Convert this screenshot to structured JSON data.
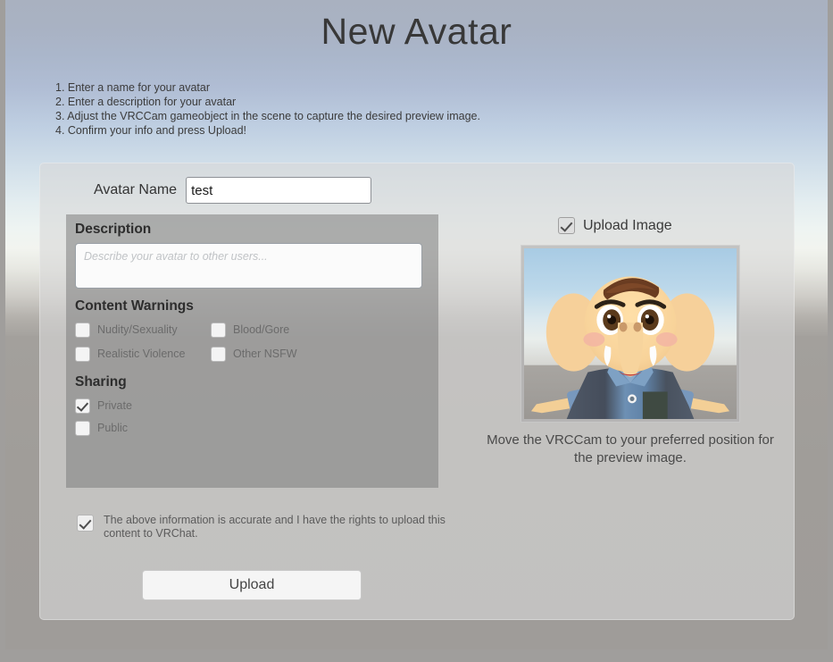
{
  "header": {
    "title": "New Avatar",
    "instructions": [
      "1. Enter a name for your avatar",
      "2. Enter a description for your avatar",
      "3. Adjust the VRCCam gameobject in the scene to capture the desired preview image.",
      "4. Confirm your info and press Upload!"
    ]
  },
  "form": {
    "avatar_name_label": "Avatar Name",
    "avatar_name_value": "test",
    "description_heading": "Description",
    "description_value": "",
    "description_placeholder": "Describe your avatar to other users...",
    "content_warnings_heading": "Content Warnings",
    "content_warnings": [
      {
        "label": "Nudity/Sexuality",
        "checked": false
      },
      {
        "label": "Blood/Gore",
        "checked": false
      },
      {
        "label": "Realistic Violence",
        "checked": false
      },
      {
        "label": "Other NSFW",
        "checked": false
      }
    ],
    "sharing_heading": "Sharing",
    "sharing": [
      {
        "label": "Private",
        "checked": true
      },
      {
        "label": "Public",
        "checked": false
      }
    ],
    "confirm_label": "The above information is accurate and I have the rights to upload this content to VRChat.",
    "confirm_checked": true,
    "upload_button_label": "Upload"
  },
  "preview": {
    "upload_image_label": "Upload Image",
    "upload_image_checked": true,
    "caption": "Move the VRCCam to your preferred position for the preview image.",
    "image_alt": "avatar-preview-elephant-character"
  },
  "colors": {
    "panel": "#d8d8d8",
    "form_box": "#787878",
    "title_text": "#383838",
    "muted_text": "#6b6b6b",
    "button_face": "#f5f5f5",
    "sky_top": "#a9b1c0",
    "ground": "#a09d99"
  }
}
